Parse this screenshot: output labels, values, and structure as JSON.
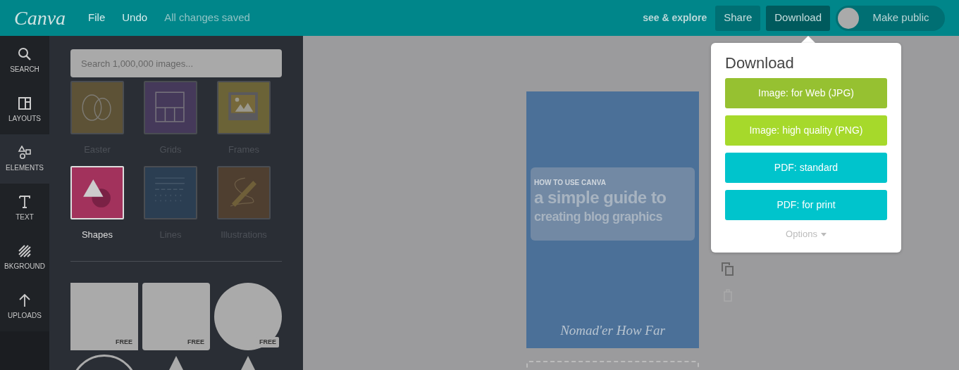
{
  "topbar": {
    "logo": "Canva",
    "menu": [
      "File",
      "Undo"
    ],
    "save_status": "All changes saved",
    "explore_link": "see & explore",
    "buttons": [
      {
        "label": "Share",
        "selected": false
      },
      {
        "label": "Download",
        "selected": true
      }
    ],
    "make_public": {
      "label": "Make public",
      "on": false
    }
  },
  "rail": {
    "items": [
      {
        "label": "SEARCH",
        "kind": "search",
        "selected": false
      },
      {
        "label": "LAYOUTS",
        "kind": "layouts",
        "selected": false
      },
      {
        "label": "ELEMENTS",
        "kind": "elements",
        "selected": true
      },
      {
        "label": "TEXT",
        "kind": "text",
        "selected": false
      },
      {
        "label": "BKGROUND",
        "kind": "background",
        "selected": false
      },
      {
        "label": "UPLOADS",
        "kind": "uploads",
        "selected": false
      }
    ]
  },
  "panel": {
    "search": {
      "placeholder": "Search 1,000,000 images..."
    },
    "categories": [
      {
        "label": "Easter",
        "kind": "easter",
        "selected": false,
        "color": "#5d5236"
      },
      {
        "label": "Grids",
        "kind": "grids",
        "selected": false,
        "color": "#45395a"
      },
      {
        "label": "Frames",
        "kind": "frames",
        "selected": false,
        "color": "#6b6337"
      },
      {
        "label": "Shapes",
        "kind": "shapes",
        "selected": true,
        "color": "#a2325c"
      },
      {
        "label": "Lines",
        "kind": "lines",
        "selected": false,
        "color": "#2b3e52"
      },
      {
        "label": "Illustrations",
        "kind": "illustrations",
        "selected": false,
        "color": "#4f3f30"
      }
    ],
    "shapes": [
      {
        "kind": "square",
        "badge": "FREE"
      },
      {
        "kind": "rounded",
        "badge": "FREE"
      },
      {
        "kind": "circle",
        "badge": "FREE"
      },
      {
        "kind": "ring"
      },
      {
        "kind": "triangle"
      },
      {
        "kind": "triangle"
      }
    ]
  },
  "design": {
    "kicker": "HOW TO USE CANVA",
    "title_lines": [
      "a simple guide to",
      "creating blog graphics"
    ],
    "signature": "Nomad'er How Far"
  },
  "download_popup": {
    "title": "Download",
    "options": [
      {
        "label": "Image: for Web (JPG)",
        "color": "#96c131"
      },
      {
        "label": "Image: high quality (PNG)",
        "color": "#a6d92b"
      },
      {
        "label": "PDF: standard",
        "color": "#00c4cc"
      },
      {
        "label": "PDF: for print",
        "color": "#00c4cc"
      }
    ],
    "options_toggle": "Options"
  }
}
